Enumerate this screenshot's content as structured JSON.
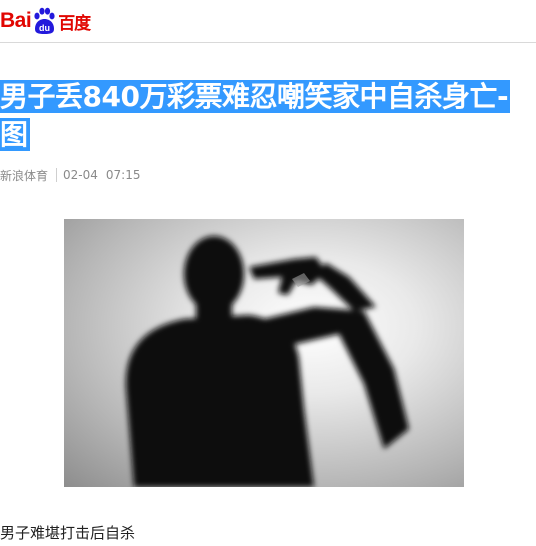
{
  "logo": {
    "latin": "Bai",
    "paw_text": "du",
    "chinese": "百度"
  },
  "article": {
    "title": "男子丢840万彩票难忍嘲笑家中自杀身亡-图",
    "source": "新浪体育",
    "date": "02-04",
    "time": "07:15",
    "caption": "男子难堪打击后自杀"
  },
  "colors": {
    "brand_red": "#e10601",
    "brand_blue": "#2319dc",
    "selection_blue": "#3399ff"
  }
}
